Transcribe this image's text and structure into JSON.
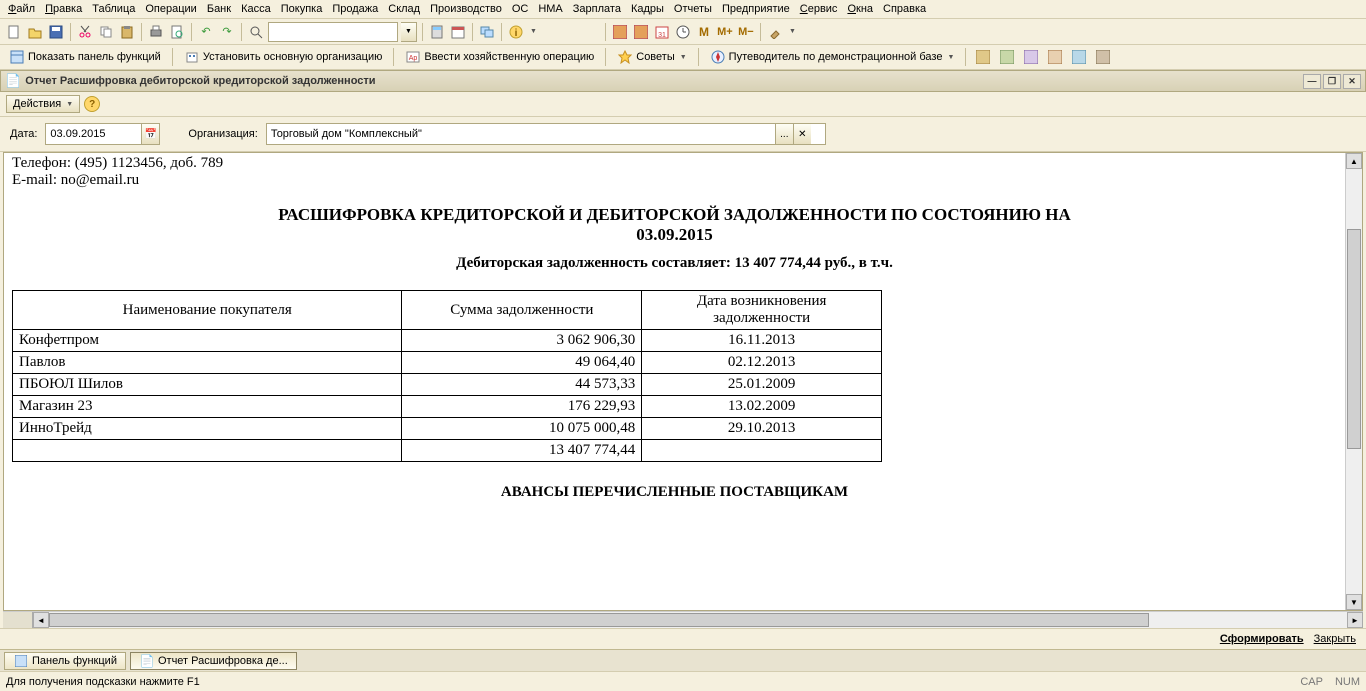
{
  "menus": [
    "Файл",
    "Правка",
    "Таблица",
    "Операции",
    "Банк",
    "Касса",
    "Покупка",
    "Продажа",
    "Склад",
    "Производство",
    "ОС",
    "НМА",
    "Зарплата",
    "Кадры",
    "Отчеты",
    "Предприятие",
    "Сервис",
    "Окна",
    "Справка"
  ],
  "menu_underlines": [
    0,
    0,
    -1,
    -1,
    -1,
    -1,
    -1,
    -1,
    -1,
    -1,
    -1,
    -1,
    -1,
    -1,
    -1,
    -1,
    0,
    0,
    -1
  ],
  "toolbar2": {
    "show_panel": "Показать панель функций",
    "set_org": "Установить основную организацию",
    "enter_op": "Ввести хозяйственную операцию",
    "tips": "Советы",
    "guide": "Путеводитель по демонстрационной базе"
  },
  "window_title": "Отчет  Расшифровка дебиторской кредиторской задолженности",
  "actions_label": "Действия",
  "date_label": "Дата:",
  "date_value": "03.09.2015",
  "org_label": "Организация:",
  "org_value": "Торговый дом \"Комплексный\"",
  "report": {
    "phone_line": "Телефон: (495) 1123456, доб. 789",
    "email_line": "E-mail: no@email.ru",
    "title_line1": "РАСШИФРОВКА КРЕДИТОРСКОЙ И ДЕБИТОРСКОЙ ЗАДОЛЖЕННОСТИ ПО СОСТОЯНИЮ НА",
    "title_line2": "03.09.2015",
    "subtitle": "Дебиторская задолженность составляет: 13 407 774,44 руб., в т.ч.",
    "columns": [
      "Наименование покупателя",
      "Сумма задолженности",
      "Дата возникновения задолженности"
    ],
    "rows": [
      {
        "name": "Конфетпром",
        "sum": "3 062 906,30",
        "date": "16.11.2013"
      },
      {
        "name": "Павлов",
        "sum": "49 064,40",
        "date": "02.12.2013"
      },
      {
        "name": "ПБОЮЛ  Шилов",
        "sum": "44 573,33",
        "date": "25.01.2009"
      },
      {
        "name": "Магазин 23",
        "sum": "176 229,93",
        "date": "13.02.2009"
      },
      {
        "name": "ИнноТрейд",
        "sum": "10 075 000,48",
        "date": "29.10.2013"
      }
    ],
    "total_row": {
      "name": "",
      "sum": "13 407 774,44",
      "date": ""
    },
    "section2_title": "АВАНСЫ ПЕРЕЧИСЛЕННЫЕ ПОСТАВЩИКАМ"
  },
  "footer": {
    "run": "Сформировать",
    "close": "Закрыть"
  },
  "taskbar": {
    "panel_func": "Панель функций",
    "report_tab": "Отчет  Расшифровка де..."
  },
  "statusbar": {
    "hint": "Для получения подсказки нажмите F1",
    "cap": "CAP",
    "num": "NUM"
  }
}
